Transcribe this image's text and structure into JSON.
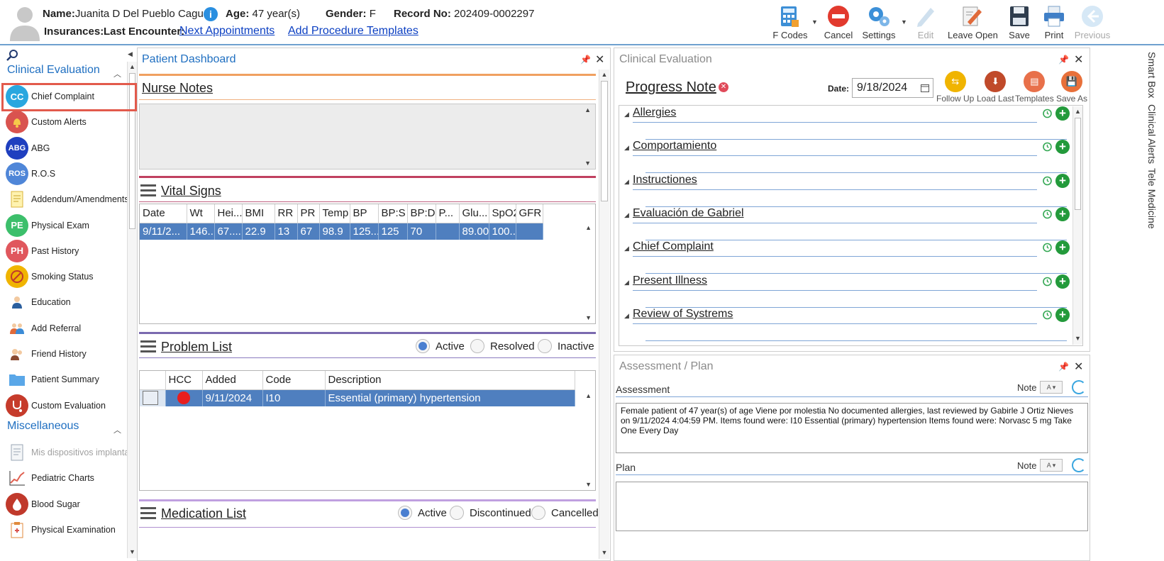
{
  "header": {
    "name_label": "Name:",
    "name": "Juanita D Del Pueblo Caguas",
    "age_label": "Age:",
    "age": "47 year(s)",
    "gender_label": "Gender:",
    "gender": "F",
    "record_label": "Record No:",
    "record": "202409-0002297",
    "insurances_label": "Insurances:",
    "last_encounter_label": "Last Encounter:",
    "next_appointments": "Next Appointments",
    "add_procedure_templates": "Add Procedure Templates"
  },
  "toolbar": {
    "f_codes": "F Codes",
    "cancel": "Cancel",
    "settings": "Settings",
    "edit": "Edit",
    "leave_open": "Leave Open",
    "save": "Save",
    "print": "Print",
    "previous": "Previous"
  },
  "sidebar": {
    "section1": "Clinical Evaluation",
    "section2": "Miscellaneous",
    "items": [
      {
        "label": "Chief Complaint",
        "icon": "CC",
        "color": "#2aa7df"
      },
      {
        "label": "Custom Alerts",
        "icon": "bell",
        "color": "#d9534f"
      },
      {
        "label": "ABG",
        "icon": "ABG",
        "color": "#1f3fbf"
      },
      {
        "label": "R.O.S",
        "icon": "ROS",
        "color": "#4f86d8"
      },
      {
        "label": "Addendum/Amendments",
        "icon": "doc",
        "color": "#e7c24a"
      },
      {
        "label": "Physical Exam",
        "icon": "PE",
        "color": "#3cbf6b"
      },
      {
        "label": "Past History",
        "icon": "PH",
        "color": "#e0575d"
      },
      {
        "label": "Smoking Status",
        "icon": "nosmoke",
        "color": "#f0b400"
      },
      {
        "label": "Education",
        "icon": "person",
        "color": "#37a8c9"
      },
      {
        "label": "Add Referral",
        "icon": "people",
        "color": "#4fa3d9"
      },
      {
        "label": "Friend History",
        "icon": "friends",
        "color": "#c0503c"
      },
      {
        "label": "Patient Summary",
        "icon": "folder",
        "color": "#5aa7e8"
      },
      {
        "label": "Custom Evaluation",
        "icon": "steth",
        "color": "#c63b2b"
      }
    ],
    "misc_items": [
      {
        "label": "Mis dispositivos implanta",
        "icon": "doc2",
        "color": "#9aa6b5",
        "dim": true
      },
      {
        "label": "Pediatric Charts",
        "icon": "chart",
        "color": "#e06050"
      },
      {
        "label": "Blood Sugar",
        "icon": "drop",
        "color": "#c0392b"
      },
      {
        "label": "Physical Examination",
        "icon": "clip",
        "color": "#e08a3c"
      }
    ]
  },
  "dashboard": {
    "title": "Patient Dashboard",
    "nurse_notes": "Nurse Notes",
    "vital_signs": "Vital Signs",
    "vital_columns": [
      "Date",
      "Wt",
      "Hei...",
      "BMI",
      "RR",
      "PR",
      "Temp",
      "BP",
      "BP:S",
      "BP:D",
      "P...",
      "Glu...",
      "SpO2",
      "GFR"
    ],
    "vital_rows": [
      [
        "9/11/2...",
        "146...",
        "67....",
        "22.9",
        "13",
        "67",
        "98.9",
        "125...",
        "125",
        "70",
        "",
        "89.00",
        "100...",
        ""
      ]
    ],
    "problem_list": "Problem List",
    "problem_filters": [
      "Active",
      "Resolved",
      "Inactive"
    ],
    "problem_columns": [
      "HCC",
      "Added",
      "Code",
      "Description"
    ],
    "problem_rows": [
      {
        "hcc": "red-dot",
        "added": "9/11/2024",
        "code": "I10",
        "description": "Essential (primary) hypertension"
      }
    ],
    "medication_list": "Medication List",
    "medication_filters": [
      "Active",
      "Discontinued",
      "Cancelled"
    ]
  },
  "clinical": {
    "title": "Clinical Evaluation",
    "progress_note": "Progress Note",
    "date_label": "Date:",
    "date_value": "9/18/2024",
    "actions": [
      "Follow Up",
      "Load Last",
      "Templates",
      "Save As"
    ],
    "sections": [
      "Allergies",
      "Comportamiento",
      "Instructiones",
      "Evaluación de Gabriel",
      "Chief Complaint",
      "Present Illness",
      "Review of Systrems"
    ]
  },
  "assessment": {
    "title": "Assessment / Plan",
    "assessment_label": "Assessment",
    "plan_label": "Plan",
    "note_label": "Note",
    "assessment_text": "Female patient of 47 year(s) of age Viene por molestia     No documented allergies, last reviewed by Gabirle J Ortiz Nieves on 9/11/2024 4:04:59 PM.     Items found were:  I10 Essential (primary) hypertension  Items found were:  Norvasc 5 mg Take One Every Day",
    "plan_text": ""
  },
  "right_tabs": [
    "Smart Box",
    "Clinical Alerts",
    "Tele Medicine"
  ]
}
